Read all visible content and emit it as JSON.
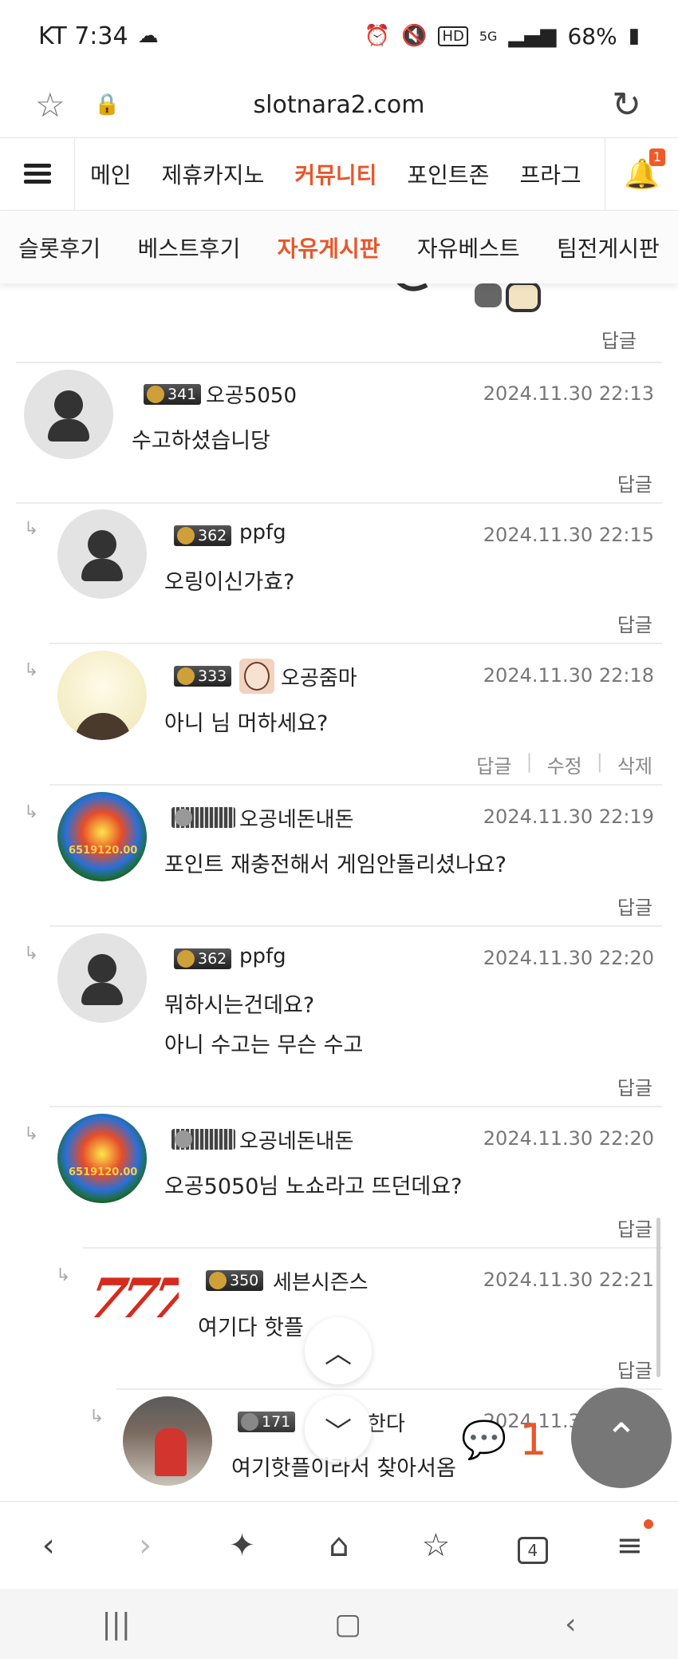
{
  "status": {
    "carrier_time": "KT 7:34",
    "battery": "68%",
    "icons": [
      "cloud-icon",
      "alarm-icon",
      "mute-icon",
      "hd-icon",
      "5g-icon",
      "signal-icon",
      "battery-icon"
    ]
  },
  "browser": {
    "url": "slotnara2.com"
  },
  "mainnav": {
    "items": [
      "메인",
      "제휴카지노",
      "커뮤니티",
      "포인트존",
      "프라그"
    ],
    "active": "커뮤니티",
    "bell_count": "1"
  },
  "subnav": {
    "items": [
      "슬롯후기",
      "베스트후기",
      "자유게시판",
      "자유베스트",
      "팀전게시판"
    ],
    "active": "자유게시판"
  },
  "reply_label": "답글",
  "edit_label": "수정",
  "delete_label": "삭제",
  "comments": [
    {
      "level": "341",
      "nick": "오공5050",
      "date": "2024.11.30 22:13",
      "lines": [
        "수고하셨습니당"
      ]
    },
    {
      "level": "362",
      "nick": "ppfg",
      "date": "2024.11.30 22:15",
      "lines": [
        "오링이신가효?"
      ]
    },
    {
      "level": "333",
      "nick": "오공줌마",
      "date": "2024.11.30 22:18",
      "lines": [
        "아니 님 머하세요?"
      ]
    },
    {
      "level": "",
      "nick": "오공네돈내돈",
      "date": "2024.11.30 22:19",
      "lines": [
        "포인트 재충전해서 게임안돌리셨나요?"
      ]
    },
    {
      "level": "362",
      "nick": "ppfg",
      "date": "2024.11.30 22:20",
      "lines": [
        "뭐하시는건데요?",
        "아니 수고는 무슨 수고"
      ]
    },
    {
      "level": "",
      "nick": "오공네돈내돈",
      "date": "2024.11.30 22:20",
      "lines": [
        "오공5050님 노쇼라고 뜨던데요?"
      ]
    },
    {
      "level": "350",
      "nick": "세븐시즌스",
      "date": "2024.11.30 22:21",
      "lines": [
        "여기다 핫플"
      ]
    },
    {
      "level": "171",
      "nick": "한다",
      "date": "2024.11.30 22:22",
      "lines": [
        "여기핫플이라서 찾아서옴"
      ]
    }
  ],
  "chat_float": {
    "count": "1"
  }
}
